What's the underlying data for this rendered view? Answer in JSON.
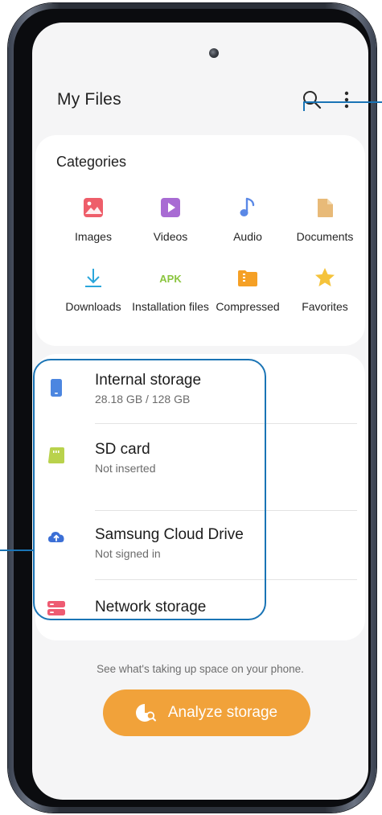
{
  "header": {
    "title": "My Files",
    "search_icon": "search-icon",
    "more_icon": "more-options-icon"
  },
  "categories": {
    "title": "Categories",
    "items": [
      {
        "label": "Images",
        "icon": "image-icon",
        "color": "#ee5e6a"
      },
      {
        "label": "Videos",
        "icon": "video-icon",
        "color": "#a86bd3"
      },
      {
        "label": "Audio",
        "icon": "music-note-icon",
        "color": "#5a88e6"
      },
      {
        "label": "Documents",
        "icon": "document-icon",
        "color": "#e8ba78"
      },
      {
        "label": "Downloads",
        "icon": "download-icon",
        "color": "#2aa6db"
      },
      {
        "label": "Installation files",
        "icon_text": "APK",
        "icon": "apk-icon",
        "color": "#8bc53f"
      },
      {
        "label": "Compressed",
        "icon": "compressed-folder-icon",
        "color": "#f5a025"
      },
      {
        "label": "Favorites",
        "icon": "star-icon",
        "color": "#f5c33b"
      }
    ]
  },
  "storage": [
    {
      "title": "Internal storage",
      "subtitle": "28.18 GB / 128 GB",
      "icon": "phone-storage-icon",
      "color": "#4c86e0"
    },
    {
      "title": "SD card",
      "subtitle": "Not inserted",
      "icon": "sd-card-icon",
      "color": "#b9d24c"
    },
    {
      "title": "Samsung Cloud Drive",
      "subtitle": "Not signed in",
      "icon": "cloud-upload-icon",
      "color": "#3b6fd6"
    },
    {
      "title": "Network storage",
      "subtitle": "",
      "icon": "network-storage-icon",
      "color": "#ee5b72"
    }
  ],
  "footer": {
    "hint": "See what's taking up space on your phone.",
    "button_label": "Analyze storage",
    "button_icon": "analyze-storage-icon",
    "button_color": "#f1a23a"
  }
}
